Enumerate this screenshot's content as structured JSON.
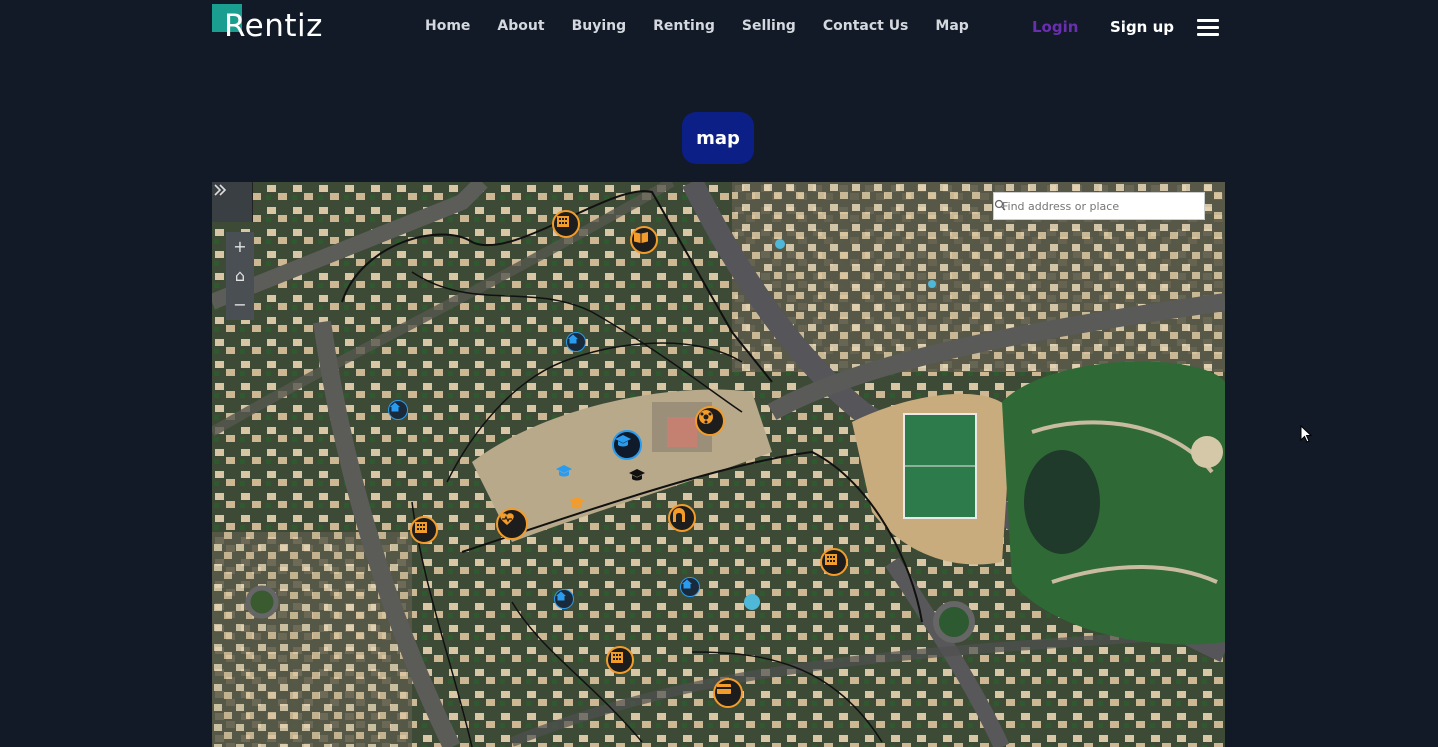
{
  "brand": {
    "name": "Rentiz",
    "accent": "#1a9e8f"
  },
  "nav": {
    "links": [
      "Home",
      "About",
      "Buying",
      "Renting",
      "Selling",
      "Contact Us",
      "Map"
    ],
    "login_label": "Login",
    "signup_label": "Sign up"
  },
  "page": {
    "badge_label": "map"
  },
  "map": {
    "search_placeholder": "Find address or place",
    "expand_icon": "chevrons-right-icon",
    "zoom_in_label": "+",
    "home_label": "⌂",
    "zoom_out_label": "−",
    "markers": [
      {
        "type": "building",
        "color": "#f39c2a"
      },
      {
        "type": "library",
        "color": "#f39c2a"
      },
      {
        "type": "home",
        "color": "#2a9cf0"
      },
      {
        "type": "home",
        "color": "#2a9cf0"
      },
      {
        "type": "school",
        "color": "#2a9cf0"
      },
      {
        "type": "school",
        "color": "#2a9cf0"
      },
      {
        "type": "school",
        "color": "#f39c2a"
      },
      {
        "type": "stadium",
        "color": "#f39c2a"
      },
      {
        "type": "hospital",
        "color": "#f39c2a"
      },
      {
        "type": "mosque",
        "color": "#f39c2a"
      },
      {
        "type": "building",
        "color": "#f39c2a"
      },
      {
        "type": "building",
        "color": "#f39c2a"
      },
      {
        "type": "home",
        "color": "#2a9cf0"
      },
      {
        "type": "home",
        "color": "#2a9cf0"
      },
      {
        "type": "building",
        "color": "#f39c2a"
      },
      {
        "type": "bank",
        "color": "#f39c2a"
      }
    ]
  }
}
